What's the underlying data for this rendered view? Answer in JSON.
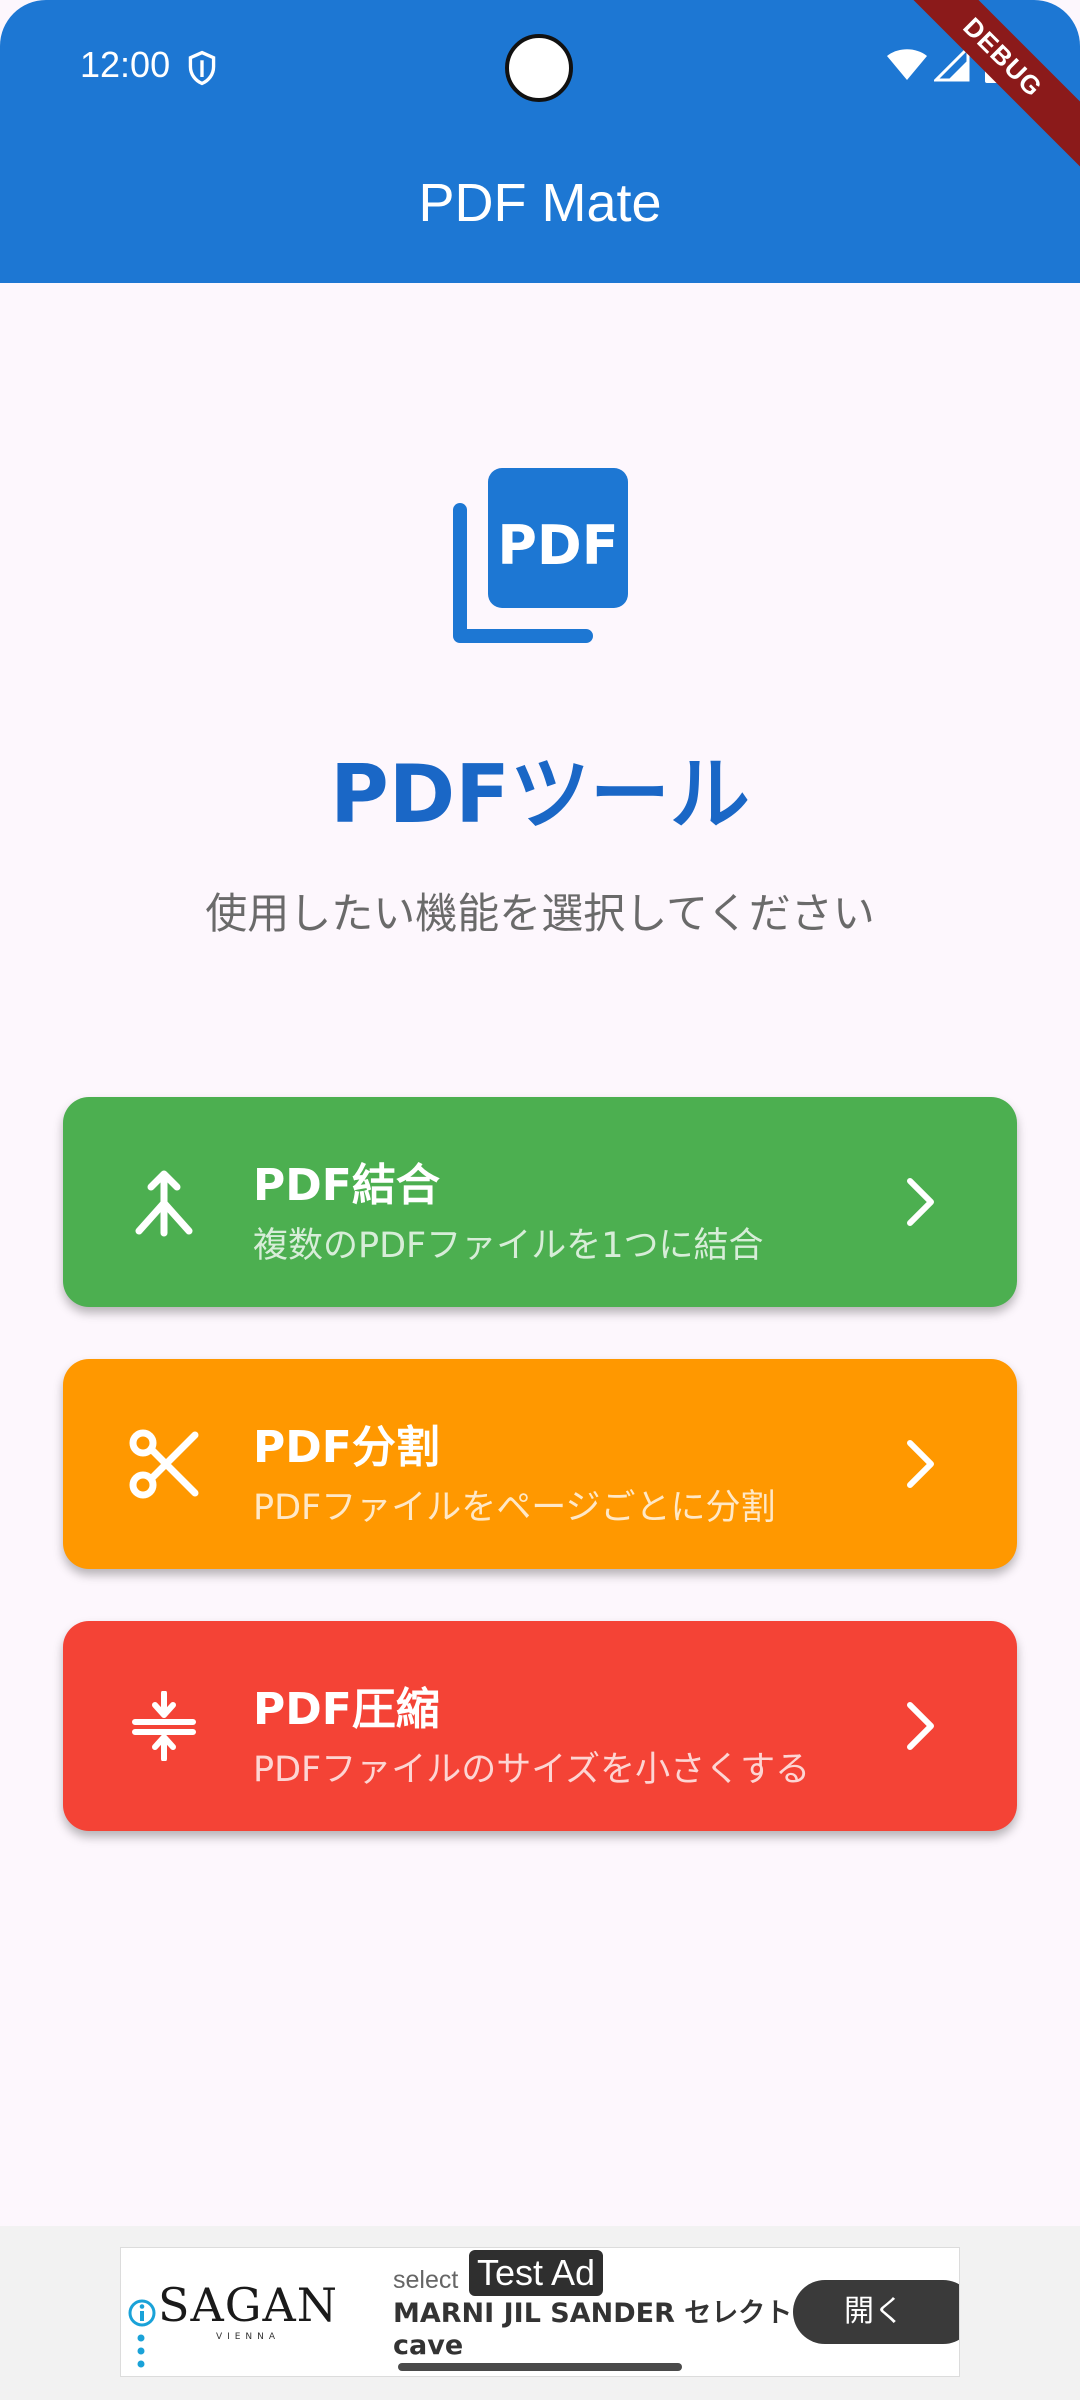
{
  "status_bar": {
    "time": "12:00"
  },
  "debug_banner": "DEBUG",
  "app_bar": {
    "title": "PDF Mate"
  },
  "hero": {
    "logo_text": "PDF",
    "title": "PDFツール",
    "subtitle": "使用したい機能を選択してください"
  },
  "tools": [
    {
      "title": "PDF結合",
      "description": "複数のPDFファイルを1つに結合",
      "color": "#4caf50",
      "icon": "merge-icon"
    },
    {
      "title": "PDF分割",
      "description": "PDFファイルをページごとに分割",
      "color": "#ff9800",
      "icon": "scissors-icon"
    },
    {
      "title": "PDF圧縮",
      "description": "PDFファイルのサイズを小さくする",
      "color": "#f44336",
      "icon": "compress-icon"
    }
  ],
  "colors": {
    "primary": "#1d77d3",
    "background": "#fdf7fd",
    "hero_title": "#1a67c6"
  },
  "ad": {
    "brand": "SAGAN",
    "brand_sub": "VIENNA",
    "label": "select",
    "badge": "Test Ad",
    "headline": "MARNI JIL SANDER セレクト cave",
    "button": "開く"
  }
}
